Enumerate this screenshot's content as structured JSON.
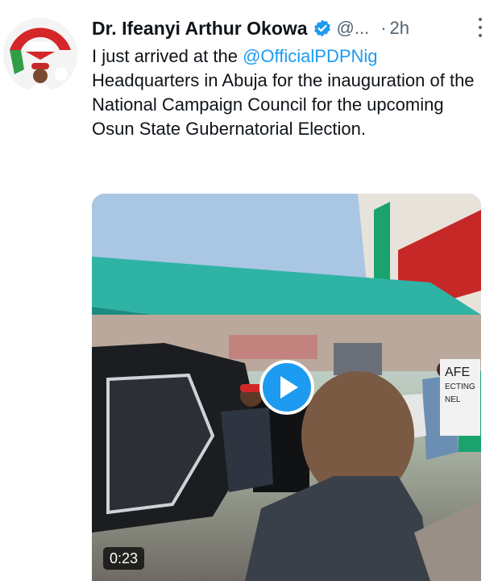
{
  "author": {
    "display_name": "Dr. Ifeanyi Arthur Okowa",
    "handle": "@...",
    "separator": "·",
    "time": "2h"
  },
  "tweet": {
    "text_before": "I just arrived at the ",
    "mention": "@OfficialPDPNig",
    "text_after": " Headquarters in Abuja for the inauguration of the National Campaign Council for the upcoming Osun State Gubernatorial Election."
  },
  "media": {
    "type": "video",
    "duration": "0:23",
    "sign_text": "AFE\nECTING\nNEL"
  },
  "colors": {
    "link": "#1d9bf0",
    "verified": "#1d9bf0",
    "secondary_text": "#536471",
    "play_button": "#1d9bf0"
  },
  "icons": [
    "avatar-image",
    "verified-badge-icon",
    "more-options-icon",
    "play-icon"
  ]
}
